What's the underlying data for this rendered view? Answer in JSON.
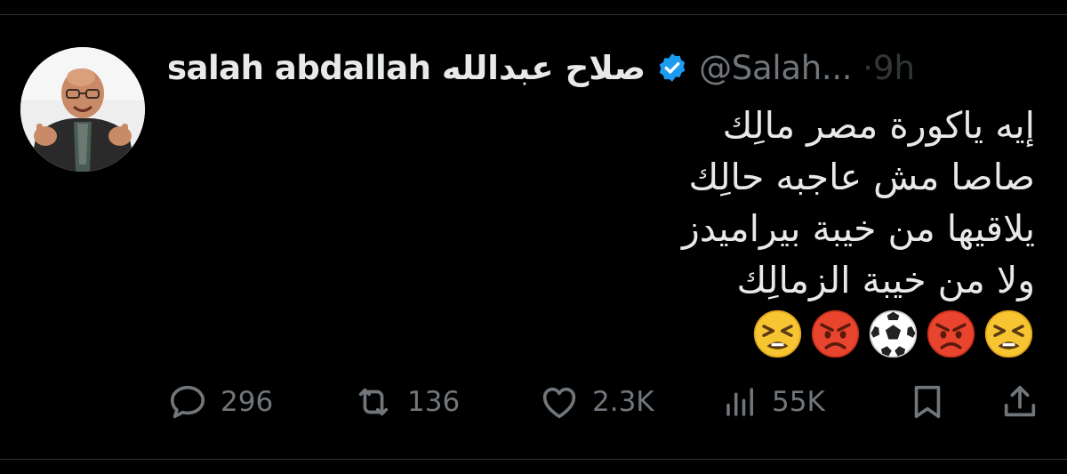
{
  "tweet": {
    "display_name": "salah abdallah صلاح عبدالله",
    "handle": "@Salah...",
    "time_fragment": "·9h",
    "lines": [
      "إيه ياكورة مصر مالِك",
      "صاصا مش عاجبه حالِك",
      "يلاقيها من خيبة بيراميدز",
      "ولا من خيبة الزمالِك"
    ],
    "emojis": [
      "tired-face",
      "pouting-face",
      "soccer-ball",
      "pouting-face",
      "tired-face"
    ]
  },
  "actions": {
    "replies": "296",
    "reposts": "136",
    "likes": "2.3K",
    "views": "55K"
  },
  "colors": {
    "background": "#000000",
    "text": "#e7e9ea",
    "muted": "#71767b",
    "verified": "#1d9bf0",
    "divider": "#2f3336"
  },
  "icons": [
    "reply-icon",
    "repost-icon",
    "like-icon",
    "views-icon",
    "bookmark-icon",
    "share-icon",
    "verified-badge-icon"
  ]
}
